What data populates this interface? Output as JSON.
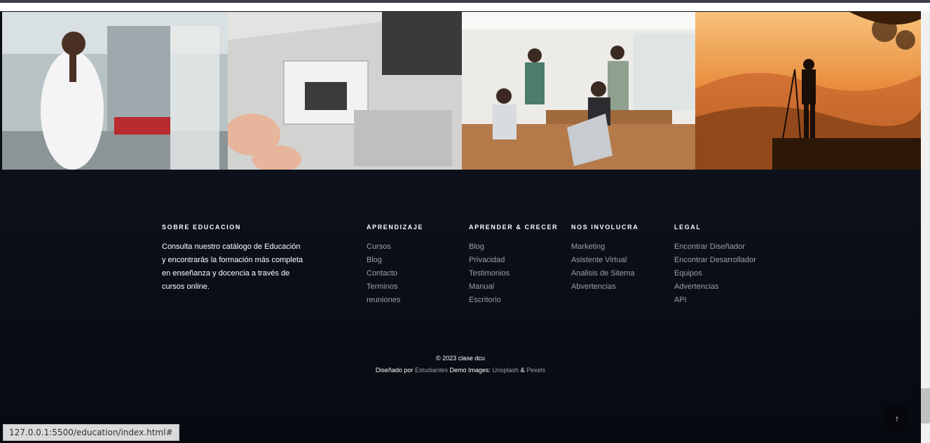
{
  "footer": {
    "about": {
      "heading": "SOBRE EDUCACION",
      "text": "Consulta nuestro catálogo de Educación y encontrarás la formación más completa en enseñanza y docencia a través de cursos online."
    },
    "columns": [
      {
        "heading": "APRENDIZAJE",
        "links": [
          "Cursos",
          "Blog",
          "Contacto",
          "Terminos",
          "reuniones"
        ]
      },
      {
        "heading": "APRENDER & CRECER",
        "links": [
          "Blog",
          "Privacidad",
          "Testimonios",
          "Manual",
          "Escritorio"
        ]
      },
      {
        "heading": "NOS INVOLUCRA",
        "links": [
          "Marketing",
          "Asistente Virtual",
          "Analisis de Sitema",
          "Abvertencias"
        ]
      },
      {
        "heading": "LEGAL",
        "links": [
          "Encontrar Diseñador",
          "Encontrar Desarrollador",
          "Equipos",
          "Advertencias",
          "API"
        ]
      }
    ],
    "copyright": "© 2023 clase dcu",
    "credit": {
      "prefix": "Diseñado por",
      "author": "Estudiantes",
      "middle": "Demo Images:",
      "source1": "Unsplash",
      "amp": "&",
      "source2": "Pexels"
    }
  },
  "gallery": {
    "images": [
      "laboratory-photo",
      "design-workshop-photo",
      "team-meeting-photo",
      "photographer-sunset-photo"
    ]
  },
  "back_to_top_icon": "arrow-up-icon",
  "status_bar": {
    "url": "127.0.0.1:5500/education/index.html#"
  }
}
